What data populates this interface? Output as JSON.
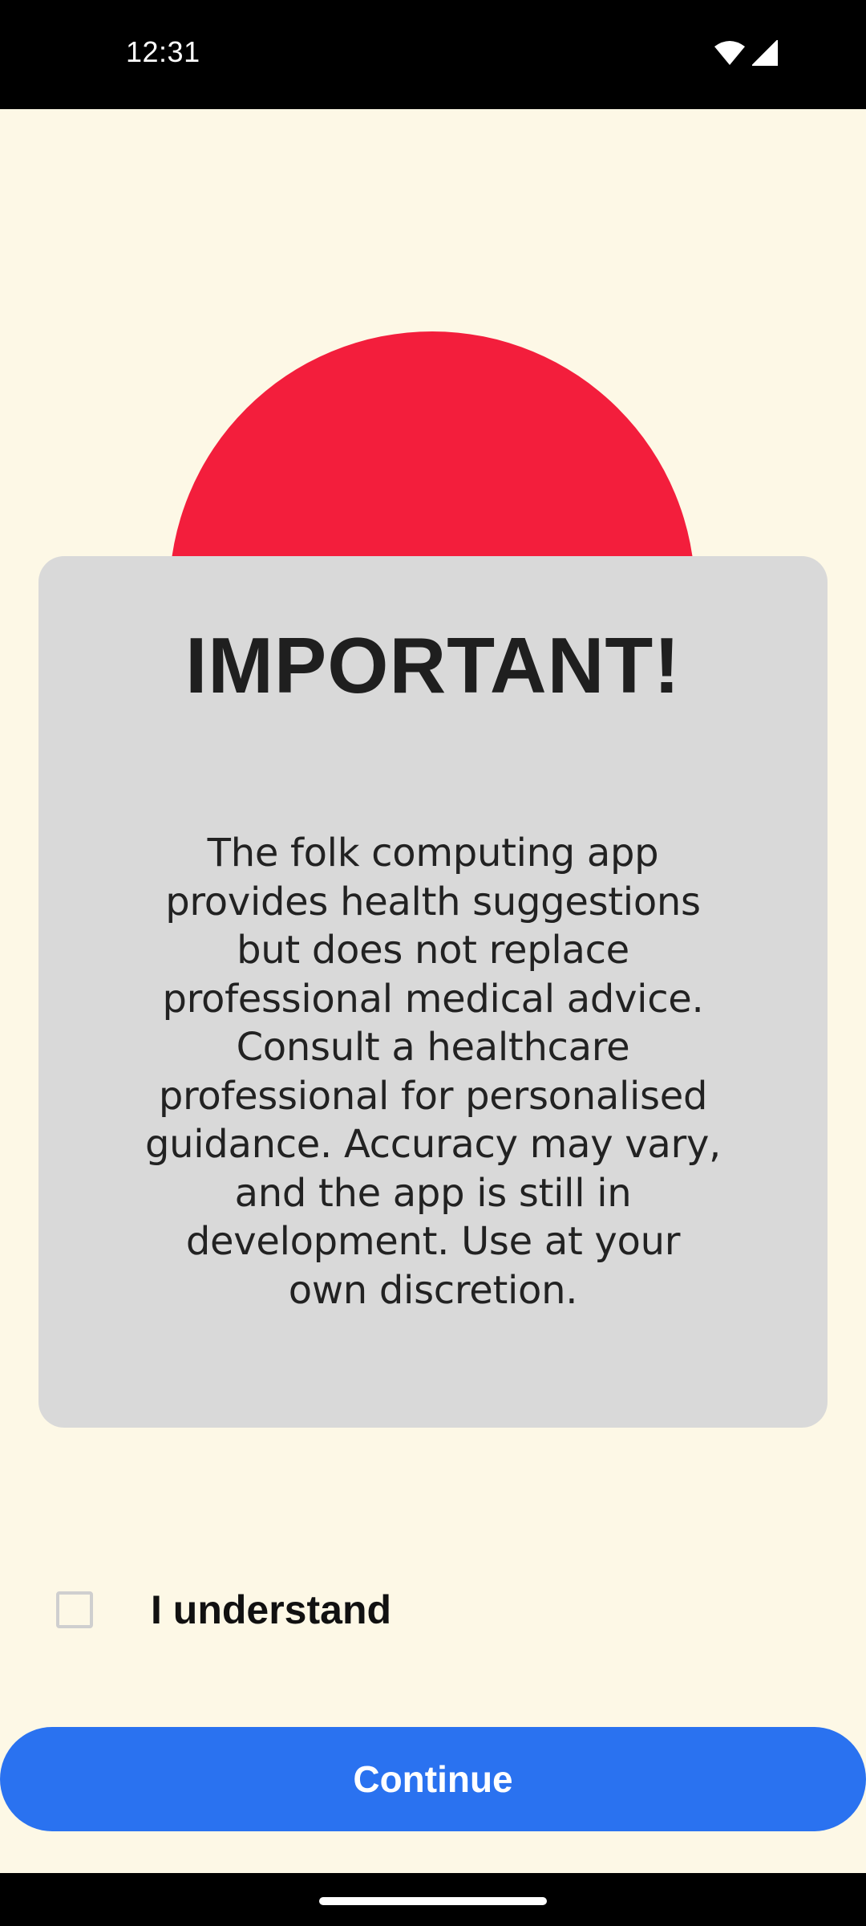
{
  "status_bar": {
    "time": "12:31",
    "icons": [
      "wifi-icon",
      "cell-signal-icon"
    ]
  },
  "dialog": {
    "title": "IMPORTANT!",
    "body": "The folk computing app provides health suggestions but does not replace professional medical advice. Consult a healthcare professional for personalised guidance. Accuracy may vary, and the app is still in development. Use at your own discretion."
  },
  "agreement": {
    "checked": false,
    "label": "I understand"
  },
  "actions": {
    "continue_label": "Continue"
  },
  "colors": {
    "background": "#fdf8e6",
    "accent_red": "#f31e3c",
    "card": "#d9d9d9",
    "primary_button": "#2a72f0"
  }
}
